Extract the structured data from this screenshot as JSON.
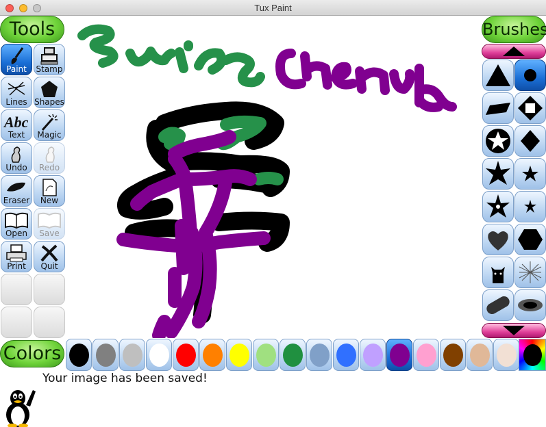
{
  "window": {
    "title": "Tux Paint"
  },
  "headers": {
    "tools": "Tools",
    "brushes": "Brushes",
    "colors": "Colors"
  },
  "tools": [
    {
      "label": "Paint",
      "icon": "paintbrush-icon",
      "selected": true,
      "disabled": false
    },
    {
      "label": "Stamp",
      "icon": "stamp-icon",
      "selected": false,
      "disabled": false
    },
    {
      "label": "Lines",
      "icon": "lines-icon",
      "selected": false,
      "disabled": false
    },
    {
      "label": "Shapes",
      "icon": "pentagon-icon",
      "selected": false,
      "disabled": false
    },
    {
      "label": "Text",
      "icon": "text-abc-icon",
      "selected": false,
      "disabled": false
    },
    {
      "label": "Magic",
      "icon": "magic-wand-icon",
      "selected": false,
      "disabled": false
    },
    {
      "label": "Undo",
      "icon": "undo-icon",
      "selected": false,
      "disabled": false
    },
    {
      "label": "Redo",
      "icon": "redo-icon",
      "selected": false,
      "disabled": true
    },
    {
      "label": "Eraser",
      "icon": "eraser-icon",
      "selected": false,
      "disabled": false
    },
    {
      "label": "New",
      "icon": "new-page-icon",
      "selected": false,
      "disabled": false
    },
    {
      "label": "Open",
      "icon": "open-book-icon",
      "selected": false,
      "disabled": false
    },
    {
      "label": "Save",
      "icon": "save-book-icon",
      "selected": false,
      "disabled": true
    },
    {
      "label": "Print",
      "icon": "printer-icon",
      "selected": false,
      "disabled": false
    },
    {
      "label": "Quit",
      "icon": "quit-x-icon",
      "selected": false,
      "disabled": false
    }
  ],
  "brushes": [
    {
      "icon": "triangle-brush-icon",
      "selected": false
    },
    {
      "icon": "round-brush-icon",
      "selected": true
    },
    {
      "icon": "diamond-flat-brush-icon",
      "selected": false
    },
    {
      "icon": "square-diamond-brush-icon",
      "selected": false
    },
    {
      "icon": "star-outline-brush-icon",
      "selected": false
    },
    {
      "icon": "diamond-brush-icon",
      "selected": false
    },
    {
      "icon": "flower-large-brush-icon",
      "selected": false
    },
    {
      "icon": "star-small-brush-icon",
      "selected": false
    },
    {
      "icon": "flower-dotted-brush-icon",
      "selected": false
    },
    {
      "icon": "star-tiny-brush-icon",
      "selected": false
    },
    {
      "icon": "heart-brush-icon",
      "selected": false
    },
    {
      "icon": "hexagon-brush-icon",
      "selected": false
    },
    {
      "icon": "cat-brush-icon",
      "selected": false
    },
    {
      "icon": "net-brush-icon",
      "selected": false
    },
    {
      "icon": "capsule-brush-icon",
      "selected": false
    },
    {
      "icon": "blur-oval-brush-icon",
      "selected": false
    }
  ],
  "colors": [
    {
      "name": "black",
      "hex": "#000000",
      "selected": false
    },
    {
      "name": "gray",
      "hex": "#808080",
      "selected": false
    },
    {
      "name": "light-gray",
      "hex": "#bfbfbf",
      "selected": false
    },
    {
      "name": "white",
      "hex": "#ffffff",
      "selected": false
    },
    {
      "name": "red",
      "hex": "#ff0000",
      "selected": false
    },
    {
      "name": "orange",
      "hex": "#ff8000",
      "selected": false
    },
    {
      "name": "yellow",
      "hex": "#ffff00",
      "selected": false
    },
    {
      "name": "light-green",
      "hex": "#a0e080",
      "selected": false
    },
    {
      "name": "green",
      "hex": "#209040",
      "selected": false
    },
    {
      "name": "steel-blue",
      "hex": "#80a0c8",
      "selected": false
    },
    {
      "name": "blue",
      "hex": "#3070ff",
      "selected": false
    },
    {
      "name": "lavender",
      "hex": "#c0a0ff",
      "selected": false
    },
    {
      "name": "purple",
      "hex": "#800090",
      "selected": true
    },
    {
      "name": "pink",
      "hex": "#ffa0d0",
      "selected": false
    },
    {
      "name": "brown",
      "hex": "#804000",
      "selected": false
    },
    {
      "name": "tan",
      "hex": "#e0b898",
      "selected": false
    },
    {
      "name": "beige",
      "hex": "#f2e0d4",
      "selected": false
    }
  ],
  "status": {
    "message": "Your image has been saved!"
  },
  "accent": {
    "header_green": "#6fd33a",
    "scroll_pink": "#e0409a",
    "button_blue": "#bcd6f2",
    "selected_blue": "#1a6fd6"
  }
}
